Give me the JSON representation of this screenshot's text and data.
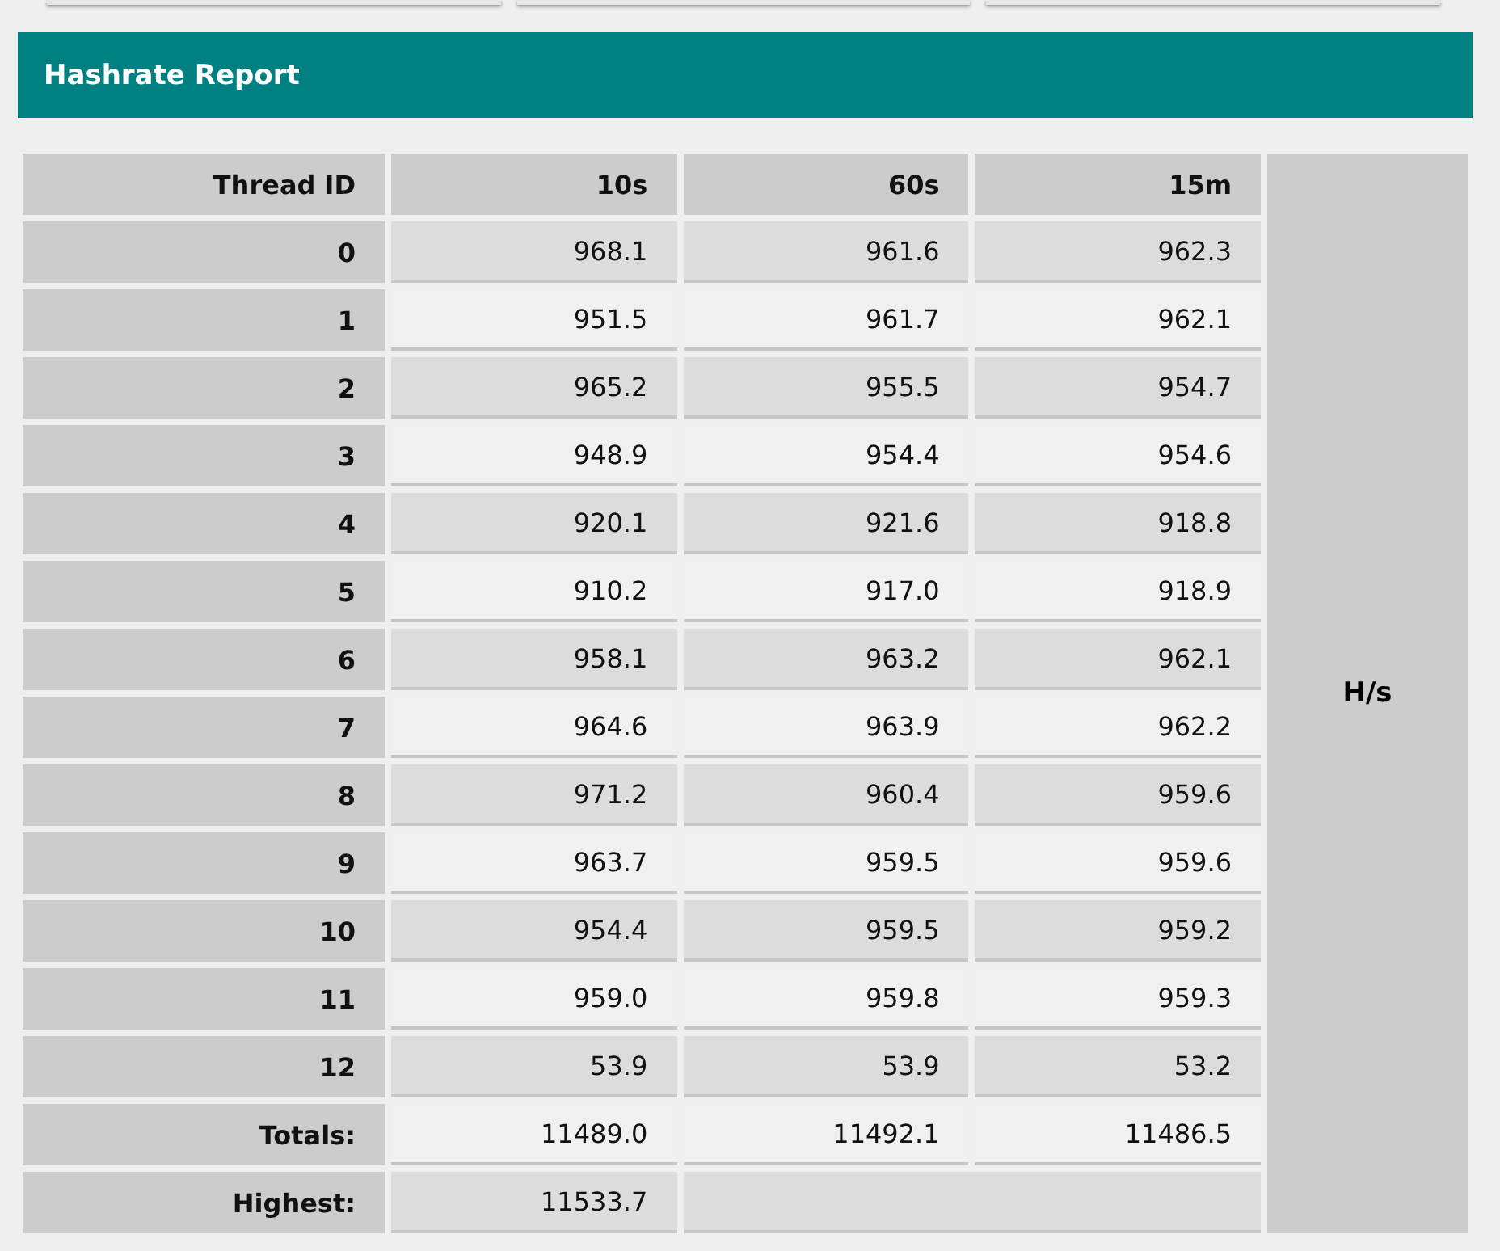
{
  "title": "Hashrate Report",
  "table": {
    "columns": [
      "Thread ID",
      "10s",
      "60s",
      "15m"
    ],
    "unit": "H/s",
    "rows": [
      {
        "label": "0",
        "values": [
          "968.1",
          "961.6",
          "962.3"
        ]
      },
      {
        "label": "1",
        "values": [
          "951.5",
          "961.7",
          "962.1"
        ]
      },
      {
        "label": "2",
        "values": [
          "965.2",
          "955.5",
          "954.7"
        ]
      },
      {
        "label": "3",
        "values": [
          "948.9",
          "954.4",
          "954.6"
        ]
      },
      {
        "label": "4",
        "values": [
          "920.1",
          "921.6",
          "918.8"
        ]
      },
      {
        "label": "5",
        "values": [
          "910.2",
          "917.0",
          "918.9"
        ]
      },
      {
        "label": "6",
        "values": [
          "958.1",
          "963.2",
          "962.1"
        ]
      },
      {
        "label": "7",
        "values": [
          "964.6",
          "963.9",
          "962.2"
        ]
      },
      {
        "label": "8",
        "values": [
          "971.2",
          "960.4",
          "959.6"
        ]
      },
      {
        "label": "9",
        "values": [
          "963.7",
          "959.5",
          "959.6"
        ]
      },
      {
        "label": "10",
        "values": [
          "954.4",
          "959.5",
          "959.2"
        ]
      },
      {
        "label": "11",
        "values": [
          "959.0",
          "959.8",
          "959.3"
        ]
      },
      {
        "label": "12",
        "values": [
          "53.9",
          "53.9",
          "53.2"
        ]
      },
      {
        "label": "Totals:",
        "values": [
          "11489.0",
          "11492.1",
          "11486.5"
        ]
      },
      {
        "label": "Highest:",
        "values": [
          "11533.7"
        ]
      }
    ]
  }
}
